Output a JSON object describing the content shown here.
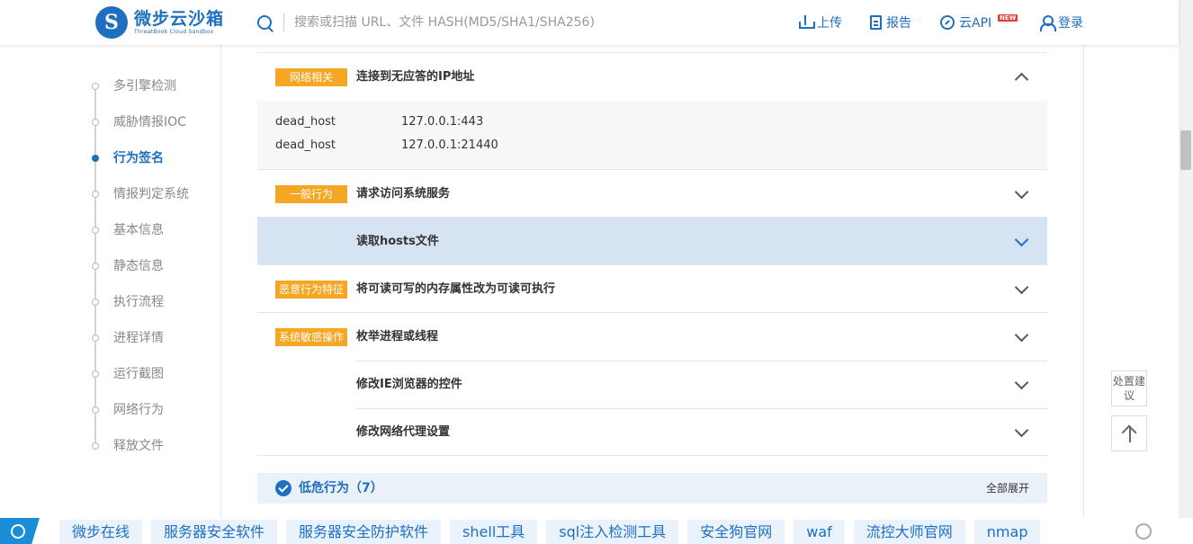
{
  "header": {
    "logo_cn": "微步云沙箱",
    "logo_en": "ThreatBook Cloud Sandbox",
    "logo_letter": "S",
    "search_placeholder": "搜索或扫描 URL、文件 HASH(MD5/SHA1/SHA256)",
    "nav": {
      "upload": "上传",
      "report": "报告",
      "api": "云API",
      "api_badge": "NEW",
      "login": "登录"
    }
  },
  "sidebar": {
    "items": [
      {
        "label": "多引擎检测",
        "active": false
      },
      {
        "label": "威胁情报IOC",
        "active": false
      },
      {
        "label": "行为签名",
        "active": true
      },
      {
        "label": "情报判定系统",
        "active": false
      },
      {
        "label": "基本信息",
        "active": false
      },
      {
        "label": "静态信息",
        "active": false
      },
      {
        "label": "执行流程",
        "active": false
      },
      {
        "label": "进程详情",
        "active": false
      },
      {
        "label": "运行截图",
        "active": false
      },
      {
        "label": "网络行为",
        "active": false
      },
      {
        "label": "释放文件",
        "active": false
      }
    ]
  },
  "main": {
    "network": {
      "tag": "网络相关",
      "title": "连接到无应答的IP地址",
      "details": [
        {
          "key": "dead_host",
          "value": "127.0.0.1:443"
        },
        {
          "key": "dead_host",
          "value": "127.0.0.1:21440"
        }
      ]
    },
    "general": {
      "tag": "一般行为",
      "items": [
        "请求访问系统服务",
        "读取hosts文件"
      ]
    },
    "malicious": {
      "tag": "恶意行为特征",
      "items": [
        "将可读可写的内存属性改为可读可执行"
      ]
    },
    "sensitive": {
      "tag": "系统敏感操作",
      "items": [
        "枚举进程或线程",
        "修改IE浏览器的控件",
        "修改网络代理设置"
      ]
    },
    "low": {
      "label": "低危行为（7）",
      "expand_all": "全部展开"
    }
  },
  "float": {
    "advice": "处置建议"
  },
  "adbar": {
    "tags": [
      "微步在线",
      "服务器安全软件",
      "服务器安全防护软件",
      "shell工具",
      "sql注入检测工具",
      "安全狗官网",
      "waf",
      "流控大师官网",
      "nmap"
    ]
  },
  "colors": {
    "brand": "#1f6fc0",
    "tag": "#f5a623",
    "highlight": "#d6e3f2"
  }
}
